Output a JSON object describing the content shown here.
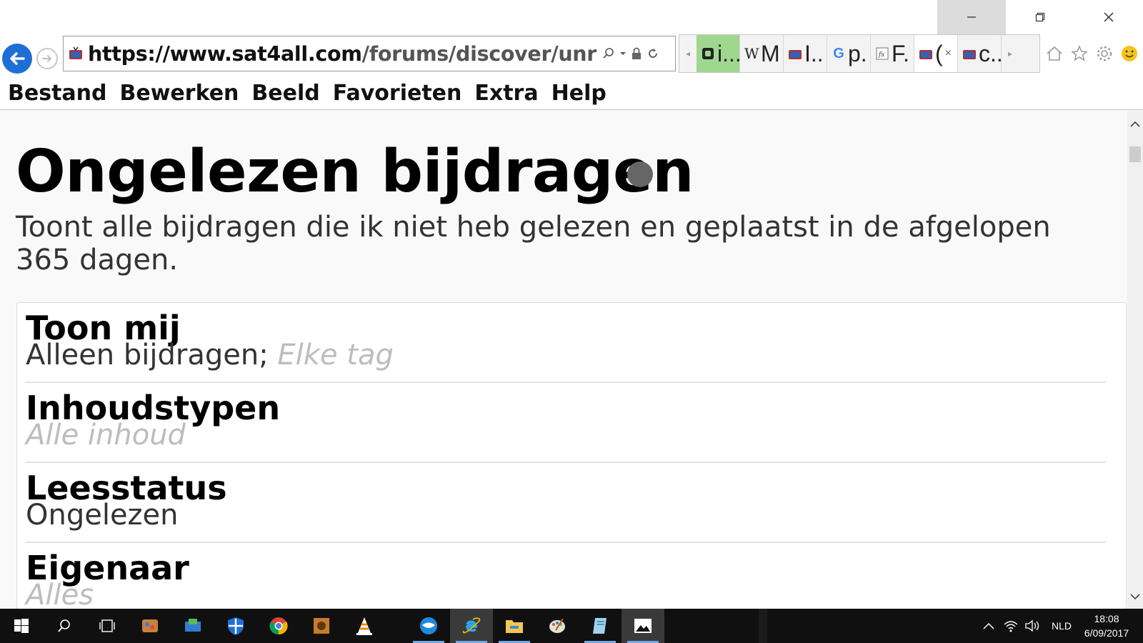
{
  "browser": {
    "url_domain": "https://www.sat4all.com",
    "url_path": "/forums/discover/unr",
    "tabs": [
      {
        "icon": "green-square-icon",
        "title": "i...",
        "state": "green"
      },
      {
        "icon": "wikipedia-icon",
        "title": "M",
        "state": "normal"
      },
      {
        "icon": "tv-icon",
        "title": "I..",
        "state": "normal"
      },
      {
        "icon": "google-icon",
        "title": "p.",
        "state": "normal"
      },
      {
        "icon": "fs-icon",
        "title": "F.",
        "state": "normal"
      },
      {
        "icon": "tv-icon",
        "title": "(",
        "state": "active"
      },
      {
        "icon": "tv-icon",
        "title": "c..",
        "state": "normal"
      }
    ],
    "tab_close": "×"
  },
  "menu": {
    "file": "Bestand",
    "edit": "Bewerken",
    "view": "Beeld",
    "favorites": "Favorieten",
    "tools": "Extra",
    "help": "Help"
  },
  "page": {
    "title": "Ongelezen bijdragen",
    "description": "Toont alle bijdragen die ik niet heb gelezen en geplaatst in de afgelopen 365 dagen.",
    "filters": [
      {
        "label": "Toon mij",
        "value": "Alleen bijdragen;",
        "value_muted": "Elke tag"
      },
      {
        "label": "Inhoudstypen",
        "value": "",
        "value_muted": "Alle inhoud"
      },
      {
        "label": "Leesstatus",
        "value": "Ongelezen",
        "value_muted": ""
      },
      {
        "label": "Eigenaar",
        "value": "",
        "value_muted": "Alles"
      }
    ]
  },
  "taskbar": {
    "language": "NLD",
    "time": "18:08",
    "date": "6/09/2017"
  },
  "colors": {
    "back_button": "#1d6fd6",
    "active_tab_green": "#9fd78f",
    "taskbar": "#101010"
  }
}
